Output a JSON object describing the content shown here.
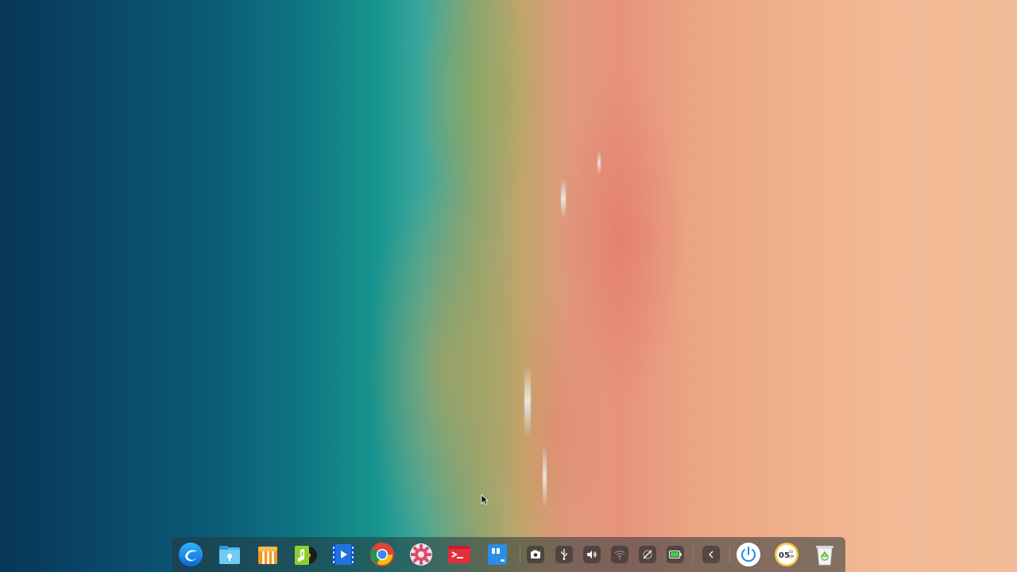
{
  "desktop": {
    "wallpaper": "aerial-beach-ocean"
  },
  "dock": {
    "apps": [
      {
        "name": "launcher",
        "icon": "deepin-launcher-icon"
      },
      {
        "name": "file-manager",
        "icon": "file-manager-icon"
      },
      {
        "name": "app-store",
        "icon": "app-store-icon"
      },
      {
        "name": "music",
        "icon": "music-icon"
      },
      {
        "name": "movie",
        "icon": "movie-icon"
      },
      {
        "name": "chrome",
        "icon": "chrome-icon"
      },
      {
        "name": "control-center",
        "icon": "settings-gear-icon"
      },
      {
        "name": "terminal",
        "icon": "terminal-icon"
      },
      {
        "name": "text-editor",
        "icon": "text-editor-icon"
      }
    ],
    "tray": [
      {
        "name": "screen-recorder",
        "icon": "camera-icon"
      },
      {
        "name": "usb",
        "icon": "usb-icon"
      },
      {
        "name": "volume",
        "icon": "volume-icon"
      },
      {
        "name": "wifi",
        "icon": "wifi-icon"
      },
      {
        "name": "network-disconnected",
        "icon": "network-disabled-icon"
      },
      {
        "name": "battery",
        "icon": "battery-icon"
      },
      {
        "name": "collapse-tray",
        "icon": "chevron-left-icon"
      }
    ],
    "clock": {
      "time": "05",
      "minutes": "50",
      "ampm": "AM"
    }
  },
  "colors": {
    "dock_bg": "#28373c",
    "ocean": "#0a4668",
    "sand": "#f1ba95"
  }
}
